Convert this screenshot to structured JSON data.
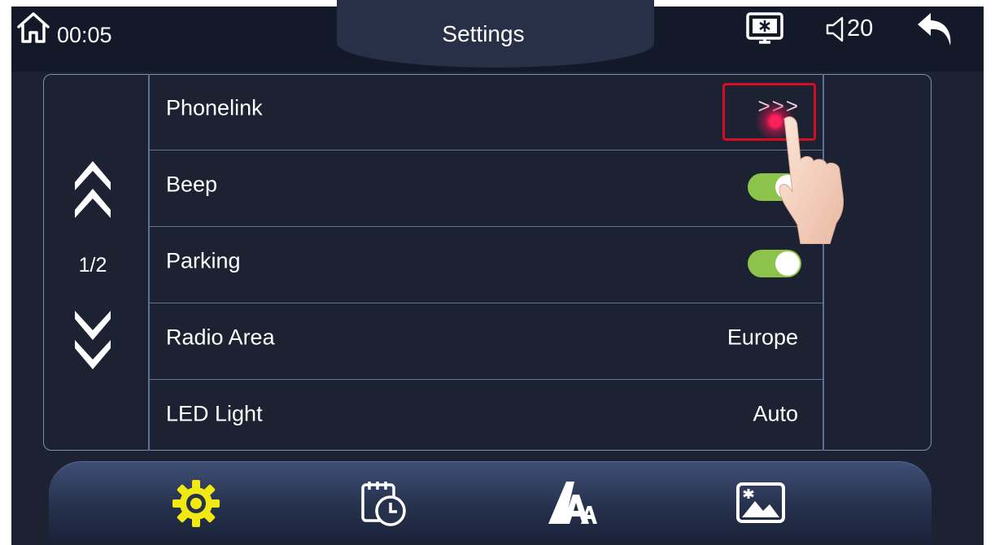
{
  "header": {
    "home_icon": "home-icon",
    "time": "00:05",
    "title": "Settings",
    "screen_icon": "screen-brightness-icon",
    "volume_icon": "volume-icon",
    "volume": "20",
    "back_icon": "back-arrow-icon"
  },
  "pager": {
    "up_icon": "double-chevron-up-icon",
    "page": "1/2",
    "down_icon": "double-chevron-down-icon"
  },
  "settings": [
    {
      "label": "Phonelink",
      "control": "link",
      "value": ">>>"
    },
    {
      "label": "Beep",
      "control": "toggle",
      "on": true
    },
    {
      "label": "Parking",
      "control": "toggle",
      "on": true
    },
    {
      "label": "Radio Area",
      "control": "value",
      "value": "Europe"
    },
    {
      "label": "LED Light",
      "control": "value",
      "value": "Auto"
    }
  ],
  "dock": [
    {
      "icon": "gear-icon",
      "active": true
    },
    {
      "icon": "calendar-clock-icon",
      "active": false
    },
    {
      "icon": "font-size-icon",
      "active": false
    },
    {
      "icon": "wallpaper-image-icon",
      "active": false
    }
  ],
  "colors": {
    "background": "#1d2233",
    "header": "#141929",
    "toggle_on": "#8cc34a",
    "active_icon": "#f0ea12",
    "highlight": "#d40d20"
  }
}
